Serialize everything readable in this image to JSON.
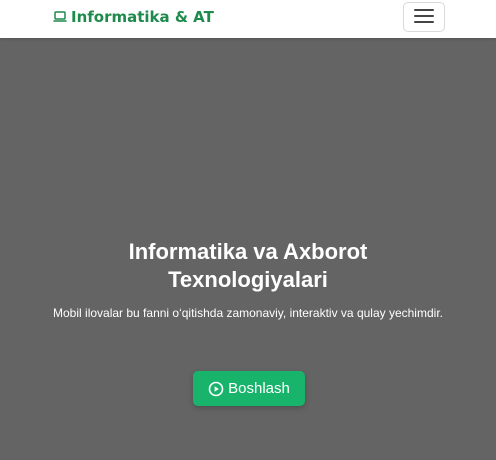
{
  "navbar": {
    "brand_label": "Informatika & AT",
    "brand_icon": "laptop-icon",
    "menu_icon": "hamburger-menu-icon",
    "brand_color": "#1e8a4c"
  },
  "hero": {
    "title": "Informatika va Axborot Texnologiyalari",
    "description": "Mobil ilovalar bu fanni o‘qitishda zamonaviy, interaktiv va qulay yechimdir.",
    "button_label": "Boshlash",
    "button_icon": "play-circle-icon",
    "background_color": "#646464",
    "button_color": "#19b46c"
  }
}
